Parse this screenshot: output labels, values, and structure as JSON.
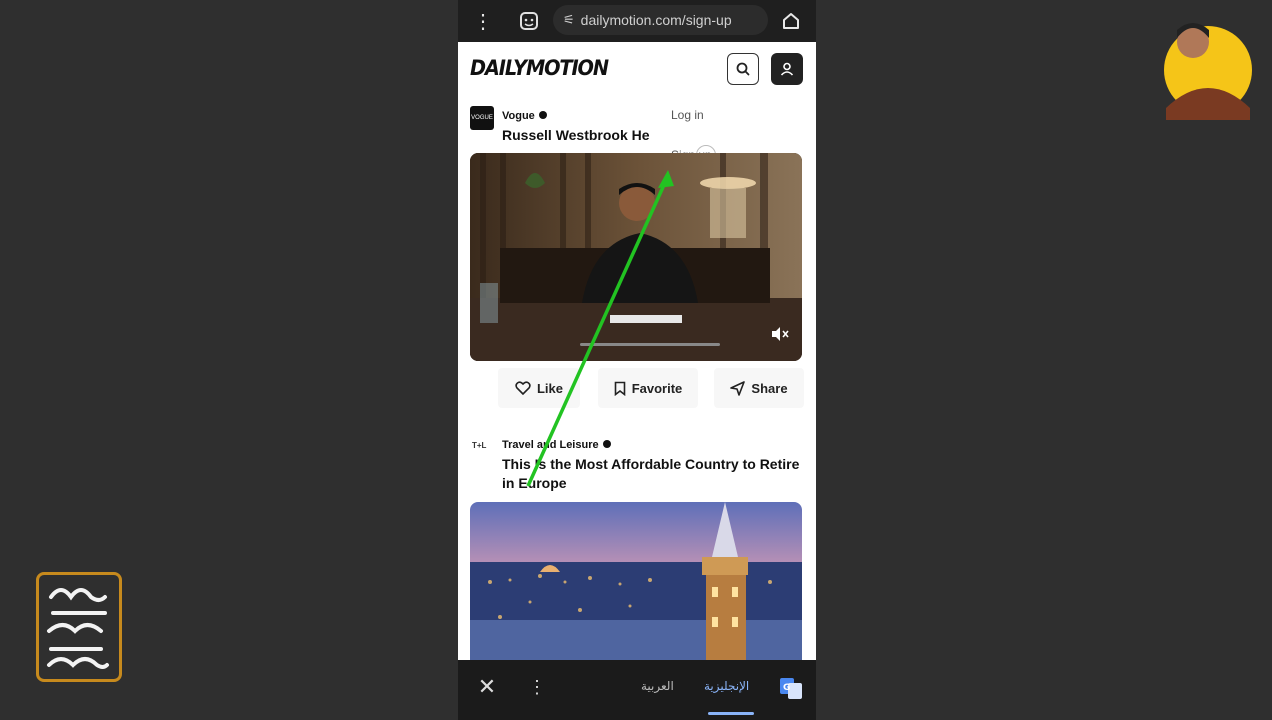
{
  "browser": {
    "url": "dailymotion.com/sign-up",
    "icons": [
      "more-vert-icon",
      "tab-switcher-icon",
      "site-settings-icon",
      "home-icon"
    ]
  },
  "header": {
    "logo": "DAILYMOTION",
    "icons": [
      "search-icon",
      "user-icon"
    ]
  },
  "account_menu": {
    "login": "Log in",
    "signup": "Sign up"
  },
  "feed": [
    {
      "channel": "Vogue",
      "channel_avatar": "VOGUE",
      "title": "Russell Westbrook He",
      "actions": {
        "like": "Like",
        "favorite": "Favorite",
        "share": "Share"
      }
    },
    {
      "channel": "Travel and Leisure",
      "channel_avatar": "T+L",
      "title": "This Is the Most Affordable Country to Retire in Europe"
    }
  ],
  "translate_bar": {
    "lang_arabic": "العربية",
    "lang_english": "الإنجليزية",
    "icons": [
      "close-icon",
      "more-vert-icon",
      "google-translate-icon"
    ]
  },
  "colors": {
    "background": "#2f2f2f",
    "annotation_arrow": "#22c322",
    "brand_logo_border": "#c78a1d",
    "avatar_ring": "#f5c518"
  }
}
